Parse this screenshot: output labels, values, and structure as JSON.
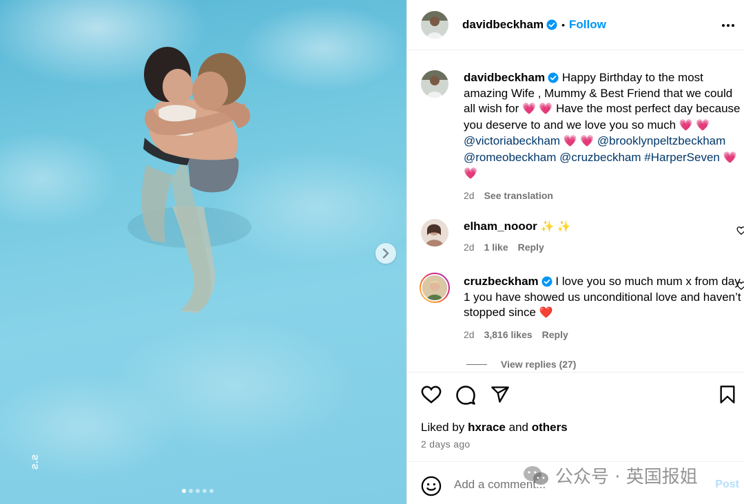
{
  "post": {
    "author": "davidbeckham",
    "follow_label": "Follow",
    "separator": "•",
    "caption": {
      "username": "davidbeckham",
      "text": "Happy Birthday to the most amazing Wife , Mummy & Best Friend that we could all wish for",
      "text2": "Have the most perfect day because you deserve to and we love you so much",
      "mentions": [
        "@victoriabeckham",
        "@brooklynpeltzbeckham",
        "@romeobeckham",
        "@cruzbeckham"
      ],
      "hashtag": "#HarperSeven",
      "time": "2d",
      "see_translation": "See translation"
    },
    "comments": [
      {
        "username": "elham_nooor",
        "text": "",
        "time": "2d",
        "likes": "1 like",
        "reply_label": "Reply"
      },
      {
        "username": "cruzbeckham",
        "text": "I love you so much mum x from day 1 you have showed us unconditional love and haven’t stopped since",
        "time": "2d",
        "likes": "3,816 likes",
        "reply_label": "Reply",
        "view_replies": "View replies (27)"
      }
    ],
    "liked_by": {
      "prefix": "Liked by",
      "user": "hxrace",
      "conj": "and",
      "others": "others"
    },
    "posted": "2 days ago",
    "comment_placeholder": "Add a comment...",
    "post_label": "Post"
  },
  "carousel": {
    "slide_count": 5,
    "active_index": 0
  },
  "watermark": {
    "text": "公众号 · 英国报姐"
  },
  "colors": {
    "accent": "#0095f6",
    "link": "#00376b",
    "muted": "#737373",
    "heart_pink": "#ff5fa2",
    "heart_red": "#e8192c"
  }
}
